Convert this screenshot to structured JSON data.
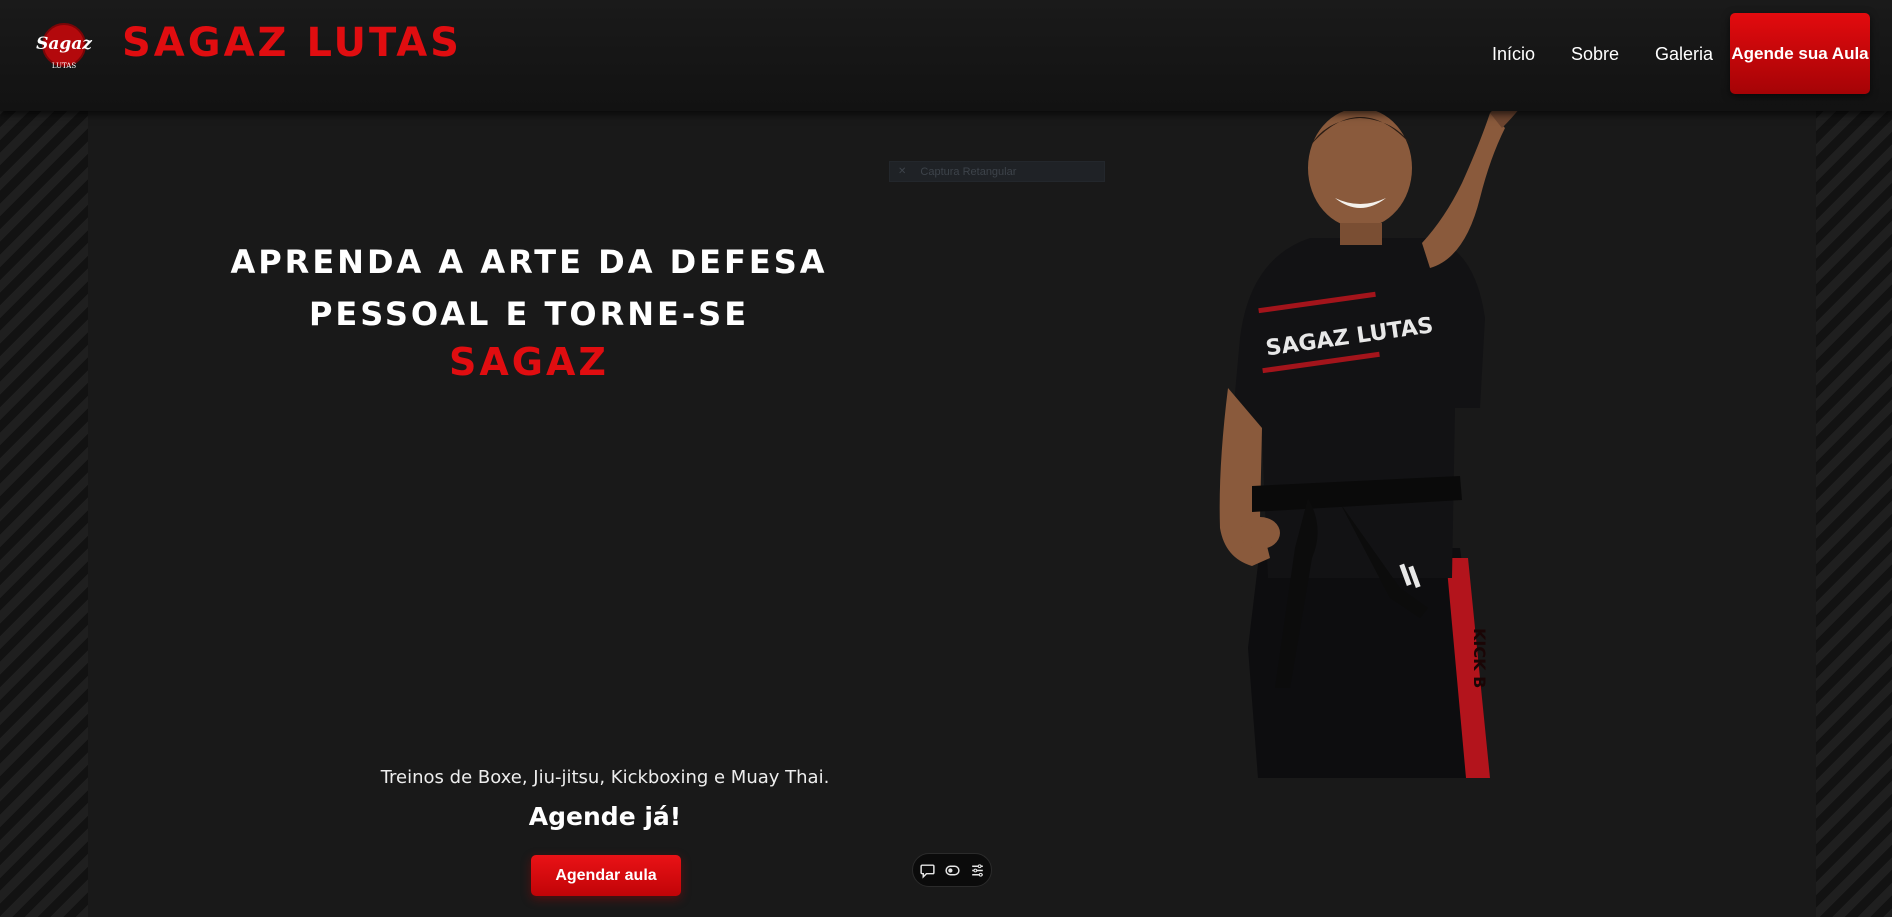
{
  "header": {
    "logo_text_top": "Sagaz",
    "logo_text_bottom": "LUTAS",
    "brand": "SAGAZ LUTAS",
    "nav": [
      {
        "label": "Início"
      },
      {
        "label": "Sobre"
      },
      {
        "label": "Galeria"
      }
    ],
    "cta_label": "Agende sua Aula"
  },
  "overlay": {
    "label": "Captura Retangular"
  },
  "hero": {
    "title_line1": "APRENDA A ARTE DA DEFESA",
    "title_line2": "PESSOAL E TORNE-SE",
    "title_highlight": "SAGAZ",
    "shirt_text": "SAGAZ LUTAS",
    "belt_text": "KICK B",
    "subtitle": "Treinos de Boxe, Jiu-jitsu, Kickboxing e Muay Thai.",
    "call": "Agende já!",
    "button_label": "Agendar aula"
  },
  "toolbar": {
    "icons": [
      "comment-icon",
      "eye-toggle-icon",
      "menu-settings-icon"
    ]
  },
  "colors": {
    "brand_red": "#e00d10",
    "background": "#191919",
    "text": "#ffffff"
  }
}
